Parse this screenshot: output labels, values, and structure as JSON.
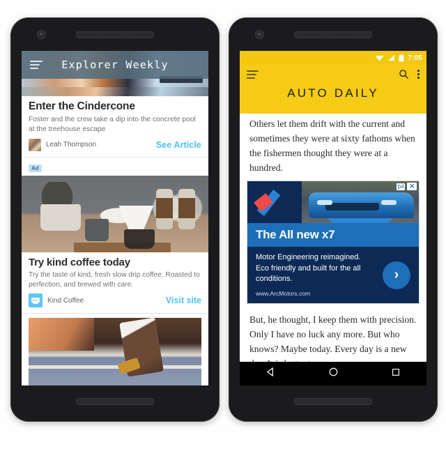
{
  "left_phone": {
    "app_bar": {
      "menu_icon": "hamburger-menu-icon",
      "title": "Explorer Weekly"
    },
    "article": {
      "headline": "Enter the Cindercone",
      "deck": "Foster and the crew take a dip into the concrete pool at the treehouse escape",
      "author": "Leah Thompson",
      "cta": "See Article",
      "avatar_icon": "author-avatar"
    },
    "native_ad": {
      "badge": "Ad",
      "image_alt": "coffee-pour-over-still-life",
      "title": "Try kind coffee today",
      "description": "Try the taste of kind, fresh slow drip coffee. Roasted to perfection, and brewed with care.",
      "advertiser": "Kind Coffee",
      "cta": "Visit site",
      "logo_icon": "kind-coffee-logo"
    },
    "second_photo_alt": "skateboarder-at-pool-coping"
  },
  "right_phone": {
    "status_bar": {
      "wifi_icon": "wifi-icon",
      "signal_icon": "signal-icon",
      "battery_icon": "battery-icon",
      "time": "7:05"
    },
    "app_bar": {
      "menu_icon": "hamburger-menu-icon",
      "search_icon": "search-icon",
      "overflow_icon": "more-vertical-icon",
      "title": "AUTO DAILY"
    },
    "story_top": "Others let them drift with the current and sometimes they were at sixty fathoms when the fishermen thought they were at a hundred.",
    "story_bottom": "But, he thought, I keep them with precision. Only I have no luck any more. But who knows? Maybe today. Every day is a new day. It is better to",
    "banner_ad": {
      "adchoices_label": "▷i",
      "close_label": "✕",
      "headline": "The All new x7",
      "copy": "Motor Engineering reimagined. Eco friendly and built for the all conditions.",
      "url": "www.ArcMotors.com",
      "arrow_label": "›",
      "logo_icon": "arc-motors-logo",
      "car_image_alt": "blue-suv-front-three-quarter"
    },
    "nav_bar": {
      "back_icon": "back-triangle-icon",
      "home_icon": "home-circle-icon",
      "recents_icon": "recents-square-icon"
    }
  },
  "colors": {
    "explorer_appbar": "#546c7c",
    "explorer_link": "#4cc3f0",
    "auto_daily_yellow": "#f5cb15",
    "banner_dark_blue": "#0d2a56",
    "banner_mid_blue": "#1d6fb8",
    "page_background": "#ffffff"
  }
}
